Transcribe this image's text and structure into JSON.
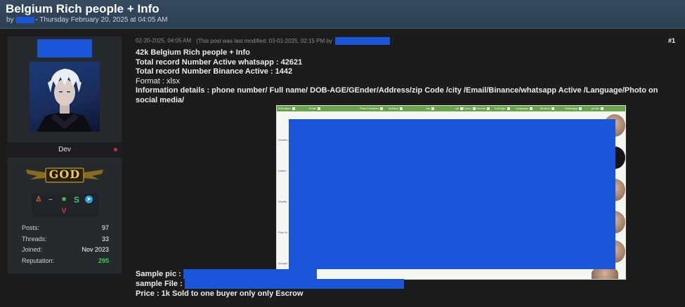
{
  "thread": {
    "title": "Belgium Rich people + Info",
    "by_prefix": "by",
    "date": "- Thursday February 20, 2025 at 04:05 AM"
  },
  "user": {
    "name": "Dev",
    "rank": "GOD",
    "icons": [
      "user-icon",
      "dash-icon",
      "lock-icon",
      "dollar-s-icon",
      "telegram-icon",
      "v-heart-icon"
    ],
    "stats": [
      {
        "label": "Posts:",
        "value": "97"
      },
      {
        "label": "Threads:",
        "value": "33"
      },
      {
        "label": "Joined:",
        "value": "Nov 2023"
      },
      {
        "label": "Reputation:",
        "value": "295"
      }
    ],
    "reputation_color": "#35d04a"
  },
  "post": {
    "date": "02-20-2025, 04:05 AM",
    "modified": "(This post was last modified: 03-01-2025, 02:15 PM by",
    "number": "#1",
    "lines": [
      "42k Belgium Rich people + Info",
      "Total record Number Active whatsapp : 42621",
      "Total record Number Binance Active : 1442",
      "Format : xlsx",
      "Information details : phone number/ Full name/ DOB-AGE/GEnder/Address/zip Code /city /Email/Binance/whatsapp Active /Language/Photo on",
      "social media/"
    ],
    "sample_columns": [
      "Full name",
      "Email",
      "Phone Number",
      "address",
      "city",
      "zip",
      "Colum",
      "Gender",
      "Dob/Age",
      "Language",
      "Binance",
      "Whatsapp",
      "profile"
    ],
    "sample_rows": [
      "Vanden",
      "Dalem",
      "Wouffy",
      "Paul Gi",
      "Incogni"
    ],
    "sample_pic_label": "Sample pic :",
    "sample_file_label": "sample File :",
    "price": "Price : 1k Sold to one buyer only only Escrow"
  },
  "colors": {
    "header_bg": "#2c3e51",
    "redaction": "#1a56d8",
    "sheet_header": "#6aa34e"
  }
}
